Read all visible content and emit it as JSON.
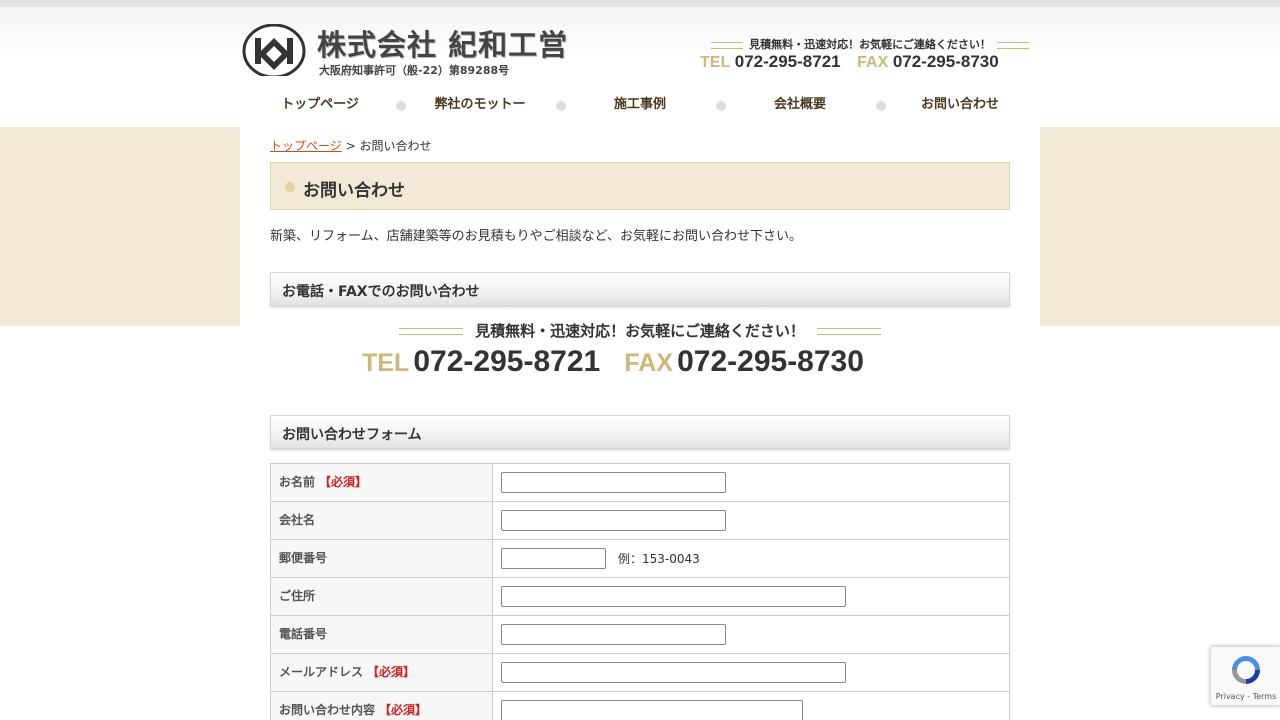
{
  "header": {
    "company_name": "株式会社 紀和工営",
    "license": "大阪府知事許可（般-22）第89288号",
    "catch": "見積無料・迅速対応！お気軽にご連絡ください！",
    "tel_label": "TEL",
    "tel": "072-295-8721",
    "fax_label": "FAX",
    "fax": "072-295-8730"
  },
  "nav": [
    {
      "label": "トップページ"
    },
    {
      "label": "弊社のモットー"
    },
    {
      "label": "施工事例"
    },
    {
      "label": "会社概要"
    },
    {
      "label": "お問い合わせ"
    }
  ],
  "breadcrumb": {
    "home": "トップページ",
    "separator": " > ",
    "current": "お問い合わせ"
  },
  "page_title": "お問い合わせ",
  "intro": "新築、リフォーム、店舗建築等のお見積もりやご相談など、お気軽にお問い合わせ下さい。",
  "phone_section": {
    "heading": "お電話・FAXでのお問い合わせ",
    "catch": "見積無料・迅速対応！お気軽にご連絡ください！",
    "tel_label": "TEL",
    "tel": "072-295-8721",
    "fax_label": "FAX",
    "fax": "072-295-8730"
  },
  "form_section": {
    "heading": "お問い合わせフォーム",
    "required_mark": "【必須】",
    "rows": [
      {
        "label": "お名前",
        "required": true
      },
      {
        "label": "会社名",
        "required": false
      },
      {
        "label": "郵便番号",
        "required": false,
        "example": "例：153-0043"
      },
      {
        "label": "ご住所",
        "required": false
      },
      {
        "label": "電話番号",
        "required": false
      },
      {
        "label": "メールアドレス",
        "required": true
      },
      {
        "label": "お問い合わせ内容",
        "required": true
      }
    ]
  },
  "recaptcha": {
    "text": "Privacy - Terms"
  },
  "colors": {
    "accent_gold": "#cdb77a",
    "beige": "#f2ead6",
    "link": "#d04a1a",
    "required": "#d02020"
  }
}
